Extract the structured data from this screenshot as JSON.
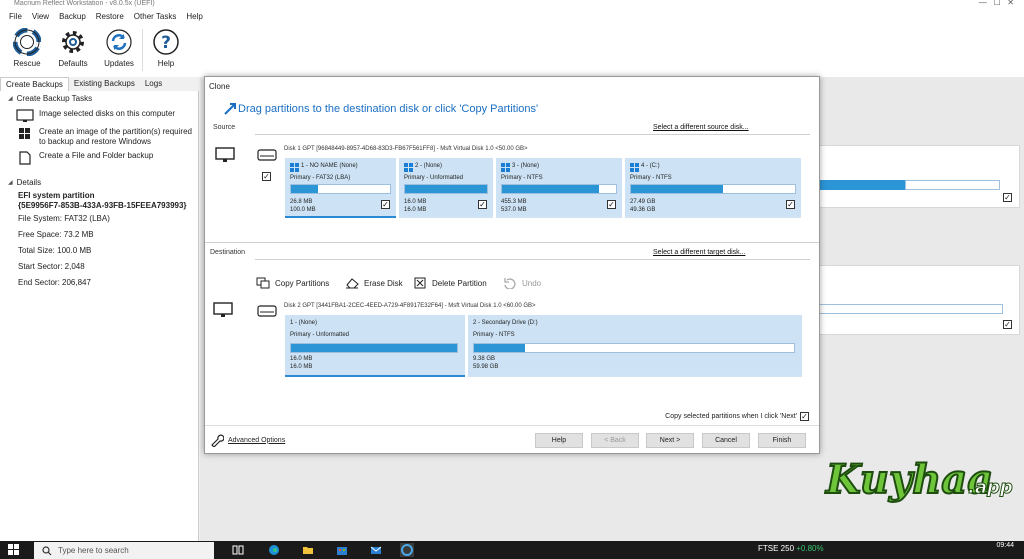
{
  "window": {
    "title": "Macrium Reflect Workstation - v8.0.5x (UEFI)"
  },
  "menu": [
    "File",
    "View",
    "Backup",
    "Restore",
    "Other Tasks",
    "Help"
  ],
  "toolbar": [
    {
      "label": "Rescue",
      "icon": "lifebuoy-icon"
    },
    {
      "label": "Defaults",
      "icon": "gear-icon"
    },
    {
      "label": "Updates",
      "icon": "refresh-icon"
    },
    {
      "label": "Help",
      "icon": "question-icon"
    }
  ],
  "left_tabs": [
    "Create Backups",
    "Existing Backups",
    "Logs"
  ],
  "left_panel": {
    "tasks_heading": "Create Backup Tasks",
    "tasks": [
      {
        "label": "Image selected disks on this computer",
        "icon": "monitor-icon"
      },
      {
        "label": "Create an image of the partition(s) required to backup and restore Windows",
        "icon": "windows-icon"
      },
      {
        "label": "Create a File and Folder backup",
        "icon": "file-icon"
      }
    ],
    "details_heading": "Details",
    "partition_name": "EFI system partition",
    "partition_id": "{5E9956F7-853B-433A-93FB-15FEEA793993}",
    "file_system": "File System:  FAT32 (LBA)",
    "free_space": "Free Space:  73.2 MB",
    "total_size": "Total Size:    100.0 MB",
    "start_sector": "Start Sector:    2,048",
    "end_sector": "End Sector:     206,847"
  },
  "dialog": {
    "title": "Clone",
    "heading": "Drag partitions to the destination disk or click 'Copy Partitions'",
    "source_label": "Source",
    "select_source": "Select a different source disk...",
    "source_disk": "Disk 1 GPT [96848449-8957-4D68-83D3-FB67F561FF8] - Msft    Virtual Disk    1.0  <50.00 GB>",
    "source_partitions": [
      {
        "name": "1 - NO NAME (None)",
        "type": "Primary - FAT32 (LBA)",
        "used": "26.8 MB",
        "total": "100.0 MB",
        "fill": 0.27,
        "checked": true,
        "selected": true
      },
      {
        "name": "2 -  (None)",
        "type": "Primary - Unformatted",
        "used": "16.0 MB",
        "total": "16.0 MB",
        "fill": 1.0,
        "checked": true,
        "selected": false
      },
      {
        "name": "3 -  (None)",
        "type": "Primary - NTFS",
        "used": "455.3 MB",
        "total": "537.0 MB",
        "fill": 0.85,
        "checked": true,
        "selected": false
      },
      {
        "name": "4 -  (C:)",
        "type": "Primary - NTFS",
        "used": "27.49 GB",
        "total": "49.36 GB",
        "fill": 0.56,
        "checked": true,
        "selected": false
      }
    ],
    "destination_label": "Destination",
    "select_target": "Select a different target disk...",
    "actions": {
      "copy": "Copy Partitions",
      "erase": "Erase Disk",
      "delete": "Delete Partition",
      "undo": "Undo"
    },
    "dest_disk": "Disk 2 GPT [3441FBA1-2CEC-4EED-A729-4F8917E32F64] - Msft    Virtual Disk    1.0  <60.00 GB>",
    "dest_partitions": [
      {
        "name": "1 -  (None)",
        "type": "Primary - Unformatted",
        "used": "16.0 MB",
        "total": "16.0 MB",
        "fill": 1.0,
        "selected": true
      },
      {
        "name": "2 - Secondary Drive (D:)",
        "type": "Primary - NTFS",
        "used": "9.38 GB",
        "total": "59.98 GB",
        "fill": 0.16,
        "selected": false
      }
    ],
    "copy_next_label": "Copy selected partitions when I click 'Next'",
    "advanced": "Advanced Options",
    "buttons": {
      "help": "Help",
      "back": "< Back",
      "next": "Next >",
      "cancel": "Cancel",
      "finish": "Finish"
    }
  },
  "taskbar": {
    "search_placeholder": "Type here to search",
    "ftse_label": "FTSE 250",
    "ftse_change": "+0.80%",
    "time": "09:44"
  },
  "colors": {
    "accent": "#2b95d6",
    "heading": "#1a6fc4",
    "partition_bg": "#cde3f5"
  }
}
